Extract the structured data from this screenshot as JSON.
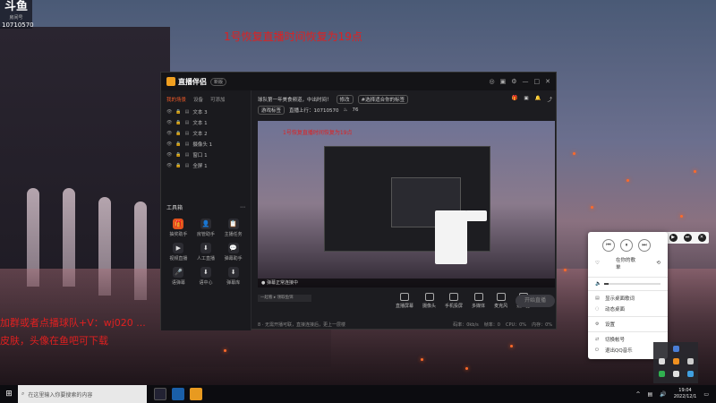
{
  "overlay": {
    "logo_text": "斗鱼",
    "logo_sub": "房间号",
    "room_number": "10710570",
    "top_notice": "1号恢复直播时间恢复为19点",
    "left_line1": "加群或者点播球队+V：wj020 ...",
    "left_line2": "皮肤，头像在鱼吧可下载"
  },
  "app": {
    "name": "直播伴侣",
    "version": "新版",
    "title_ctrls": [
      "◎",
      "▣",
      "⚙",
      "—",
      "□",
      "✕"
    ],
    "side_tabs": [
      "我的场景",
      "设备",
      "可添加"
    ],
    "scenes": [
      {
        "label": "文本 3"
      },
      {
        "label": "文本 1"
      },
      {
        "label": "文本 2"
      },
      {
        "label": "摄像头 1"
      },
      {
        "label": "窗口 1"
      },
      {
        "label": "全屏 1"
      }
    ],
    "tools_header": "工具箱",
    "tools": [
      {
        "label": "抽奖助手",
        "icon": "🎁"
      },
      {
        "label": "房管助手",
        "icon": "👤"
      },
      {
        "label": "主播任务",
        "icon": "📋"
      },
      {
        "label": "视频直播",
        "icon": "▶"
      },
      {
        "label": "人工直播",
        "icon": "⬇"
      },
      {
        "label": "弹幕助手",
        "icon": "💬"
      },
      {
        "label": "语弹幕",
        "icon": "🎤"
      },
      {
        "label": "语中心",
        "icon": "⬇"
      },
      {
        "label": "弹幕库",
        "icon": "⬇"
      }
    ],
    "info_title": "球队第一年美食频道，中出时间！",
    "info_pill1": "修改",
    "info_pill2": "#选择适合你的标签",
    "info_pill3": "游戏标签",
    "info_score": "直播上行：10710570",
    "info_viewers": "76",
    "preview_notice": "1号恢复直播时间恢复为19点",
    "preview_input": "一起看 ▸ 领取鱼饵",
    "minibar_text": "● 弹幕正常连接中",
    "bottom_tools": [
      "直播屏幕",
      "摄像头",
      "手机投屏",
      "多媒体",
      "麦克风",
      "扬声器"
    ],
    "start_live": "开始直播",
    "status_text": "8 · 无需开播可联，直接连接后，更上一层楼",
    "status_stats": [
      "码率：0kb/s",
      "帧率：0",
      "CPU：0%",
      "内存：0%"
    ]
  },
  "ctx_menu": {
    "favorite": "在你的歌单",
    "items": [
      {
        "icon": "▤",
        "label": "显示桌面歌词"
      },
      {
        "icon": "◌",
        "label": "动态桌面"
      },
      {
        "icon": "⚙",
        "label": "设置"
      },
      {
        "icon": "⇄",
        "label": "切换帐号"
      },
      {
        "icon": "⏻",
        "label": "退出QQ音乐"
      }
    ],
    "volume_level": 0.08
  },
  "taskbar": {
    "search_placeholder": "在这里输入你要搜索的内容",
    "time": "19:04",
    "date": "2022/12/1"
  }
}
